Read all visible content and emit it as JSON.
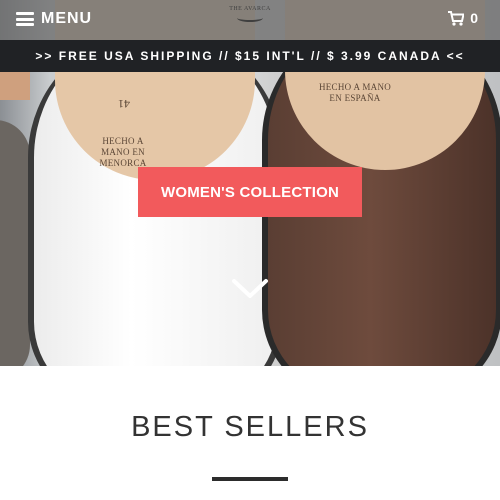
{
  "header": {
    "menu_label": "MENU",
    "logo_text": "THE AVARCA",
    "cart_count": "0"
  },
  "banner": {
    "text": ">> FREE USA SHIPPING // $15 INT'L // $ 3.99 CANADA <<"
  },
  "hero": {
    "cta_label": "WOMEN'S COLLECTION",
    "insole_left": "HECHO A MANO EN MENORCA",
    "insole_right": "HECHO A MANO EN ESPAÑA",
    "size_mark": "41"
  },
  "best_sellers": {
    "title": "BEST SELLERS"
  },
  "colors": {
    "accent": "#f25a5c",
    "banner_bg": "#202225",
    "header_bg": "#6c6c6c"
  }
}
